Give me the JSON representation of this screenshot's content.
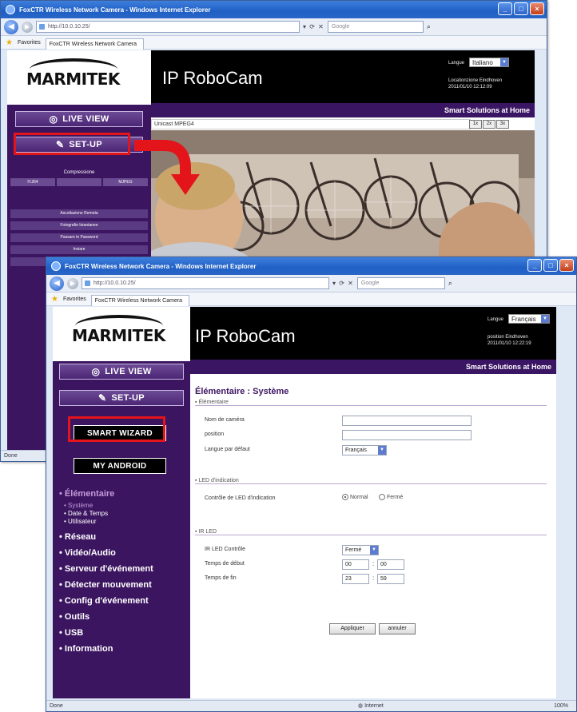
{
  "back_window": {
    "title": "FoxCTR Wireless Network Camera - Windows Internet Explorer",
    "address": "http://10.0.10.25/",
    "search_placeholder": "Google",
    "tab": "FoxCTR Wireless Network Camera",
    "favorites": "Favorites",
    "brand": "MARMITEK",
    "app_title": "IP RoboCam",
    "lang_label": "Langue",
    "lang_value": "Italiano",
    "location_line1": "Locationzione Eindhoven",
    "location_line2": "2011/01/10 12:12:09",
    "slogan": "Smart Solutions at Home",
    "live_view": "LIVE VIEW",
    "setup": "SET-UP",
    "compression_label": "Compressione",
    "codecs": [
      "H.264",
      "",
      "MJPEG"
    ],
    "menu": [
      "Ascoltazione Remota",
      "Fotografie Istantanee",
      "Passare le Password",
      "Inviare",
      ""
    ],
    "video_mode": "Unicast MPEG4",
    "zoom_buttons": [
      "1x",
      "2x",
      "3x"
    ],
    "status": "Done"
  },
  "front_window": {
    "title": "FoxCTR Wireless Network Camera - Windows Internet Explorer",
    "address": "http://10.0.10.25/",
    "search_placeholder": "Google",
    "tab": "FoxCTR Wireless Network Camera",
    "favorites": "Favorites",
    "brand": "MARMITEK",
    "app_title": "IP RoboCam",
    "lang_label": "Langue",
    "lang_value": "Français",
    "location_line1": "position Eindhoven",
    "location_line2": "2011/01/10 12:22:19",
    "slogan": "Smart Solutions at Home",
    "live_view": "LIVE VIEW",
    "setup": "SET-UP",
    "smart_wizard": "SMART WIZARD",
    "my_android": "MY ANDROID",
    "menu": {
      "elementaire": "Élémentaire",
      "sub": [
        "Système",
        "Date & Temps",
        "Utilisateur"
      ],
      "items": [
        "Réseau",
        "Vidéo/Audio",
        "Serveur d'événement",
        "Détecter mouvement",
        "Config d'événement",
        "Outils",
        "USB",
        "Information"
      ]
    },
    "page_title": "Élémentaire : Système",
    "section1": "Élémentaire",
    "camera_name_label": "Nom de caméra",
    "position_label": "position",
    "language_label": "Langue par défaut",
    "language_value": "Français",
    "section2": "LED d'indication",
    "led_label": "Contrôle de LED d'indication",
    "led_normal": "Normal",
    "led_off": "Fermé",
    "section3": "IR LED",
    "ir_control_label": "IR LED Contrôle",
    "ir_control_value": "Fermé",
    "start_label": "Temps de début",
    "start_h": "00",
    "start_m": "00",
    "end_label": "Temps de fin",
    "end_h": "23",
    "end_m": "59",
    "apply": "Appliquer",
    "cancel": "annuler",
    "status": "Done",
    "status_zone": "Internet",
    "zoom": "100%"
  },
  "colors": {
    "accent_purple": "#3c1561",
    "highlight_red": "#e3151b",
    "header_black": "#000000"
  }
}
